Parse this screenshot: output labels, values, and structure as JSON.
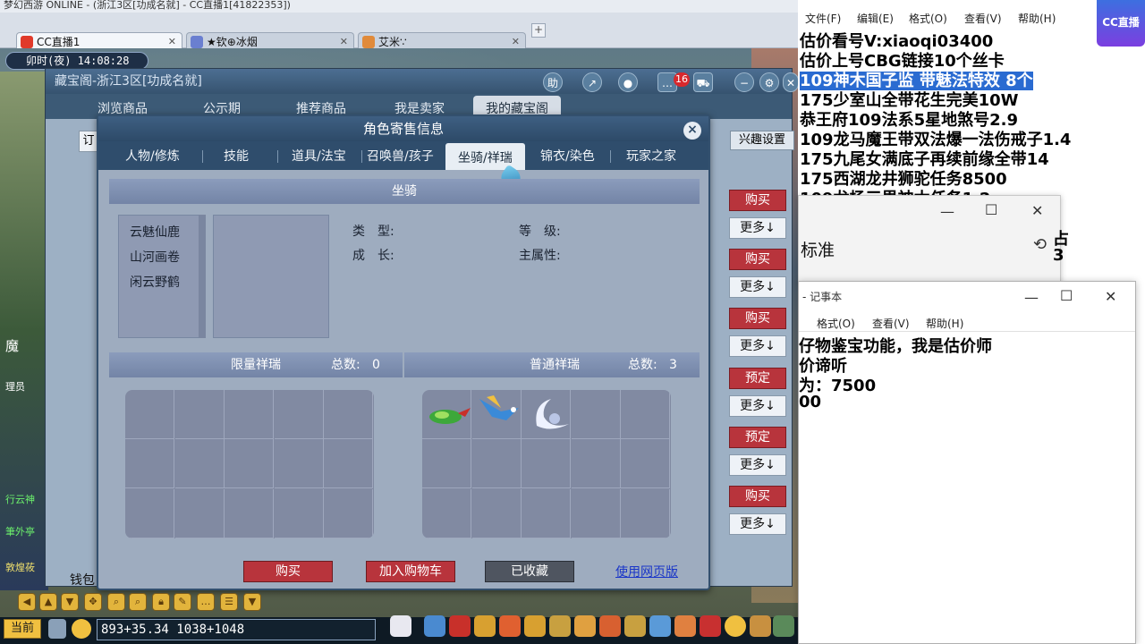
{
  "browser": {
    "window_title": "梦幻西游 ONLINE - (浙江3区[功成名就] - CC直播1[41822353])",
    "tabs": [
      {
        "label": "CC直播1",
        "icon": "cc-icon",
        "icon_color": "#e03a2a"
      },
      {
        "label": "★钦⊕冰烟",
        "icon": "avatar-icon",
        "icon_color": "#6a7fd0"
      },
      {
        "label": "艾米∵",
        "icon": "avatar-icon",
        "icon_color": "#e08a3a"
      }
    ]
  },
  "game": {
    "clock": "卯时(夜) 14:08:28",
    "left_tags": [
      "魔",
      "理员"
    ],
    "left_names": [
      "行云神",
      "筆外亭",
      "敦煌莜"
    ],
    "coords": "893+35.34 1038+1048",
    "channel": "当前"
  },
  "cbg": {
    "title": "藏宝阁-浙江3区[功成名就]",
    "nav": [
      "浏览商品",
      "公示期",
      "推荐商品",
      "我是卖家",
      "我的藏宝阁"
    ],
    "help_label": "助",
    "cart_count": "16",
    "sort_label": "订",
    "interest_label": "兴趣设置",
    "row_buttons": [
      {
        "action": "购买",
        "more": "更多↓"
      },
      {
        "action": "购买",
        "more": "更多↓"
      },
      {
        "action": "购买",
        "more": "更多↓"
      },
      {
        "action": "预定",
        "more": "更多↓"
      },
      {
        "action": "预定",
        "more": "更多↓"
      },
      {
        "action": "购买",
        "more": "更多↓"
      }
    ],
    "wallet_label": "钱包"
  },
  "dialog": {
    "title": "角色寄售信息",
    "close": "×",
    "tabs": [
      "人物/修炼",
      "技能",
      "道具/法宝",
      "召唤兽/孩子",
      "坐骑/祥瑞",
      "锦衣/染色",
      "玩家之家"
    ],
    "active_tab": 4,
    "mount_section_title": "坐骑",
    "mounts": [
      "云魅仙鹿",
      "山河画卷",
      "闲云野鹤"
    ],
    "attributes": {
      "type_label": "类　型:",
      "level_label": "等　级:",
      "growth_label": "成　长:",
      "main_attr_label": "主属性:"
    },
    "limited": {
      "title": "限量祥瑞",
      "count_label": "总数:",
      "count": "0"
    },
    "normal": {
      "title": "普通祥瑞",
      "count_label": "总数:",
      "count": "3",
      "items": [
        "green-beast-icon",
        "blue-bird-icon",
        "white-crescent-icon"
      ]
    },
    "buttons": {
      "buy": "购买",
      "add_cart": "加入购物车",
      "favorited": "已收藏",
      "web": "使用网页版"
    }
  },
  "notepad": {
    "menu": [
      "文件(F)",
      "编辑(E)",
      "格式(O)",
      "查看(V)",
      "帮助(H)"
    ],
    "lines": [
      "估价看号V:xiaoqi03400",
      "估价上号CBG链接10个丝卡",
      "109神木国子监 带魅法特效 8个",
      "175少室山全带花生完美10W",
      "恭王府109法系5星地煞号2.9",
      "109龙马魔王带双法爆一法伤戒子1.4",
      "175九尾女满底子再续前缘全带14",
      "175西湖龙井狮驼任务8500",
      "109龙杨三界神木任务1.2"
    ],
    "highlight_line": 2,
    "cc_logo": "CC直播"
  },
  "calc_window": {
    "mode": "标准",
    "side_text_1": "占",
    "side_text_2": "3",
    "controls": [
      "—",
      "☐",
      "✕"
    ]
  },
  "notepad2": {
    "title": "- 记事本",
    "menu": [
      "格式(O)",
      "查看(V)",
      "帮助(H)"
    ],
    "lines": [
      "仔物鉴宝功能，我是估价师",
      "价谛听",
      "为：7500",
      "00"
    ],
    "controls": [
      "—",
      "☐",
      "✕"
    ]
  }
}
